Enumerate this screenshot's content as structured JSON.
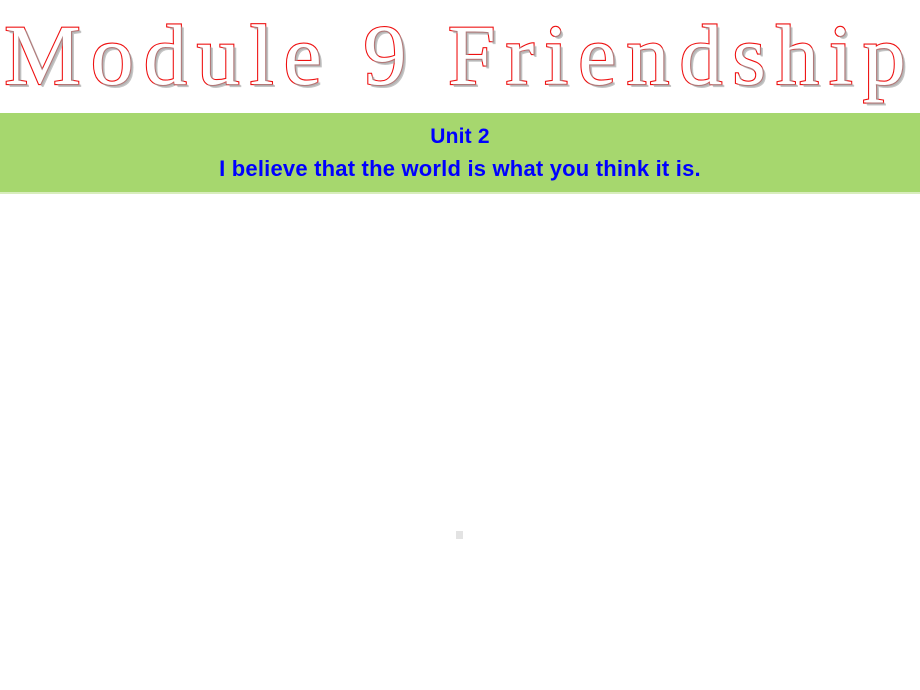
{
  "slide": {
    "title": "Module 9 Friendship",
    "banner": {
      "line1": "Unit 2",
      "line2": "I believe that the world is what you think it is."
    },
    "body": {
      "content": ""
    }
  },
  "colors": {
    "title_fill": "#FFFFFF",
    "title_outline": "#EE1111",
    "title_shadow": "#969696",
    "banner_background": "#A6D76E",
    "banner_edge": "#D8EDBD",
    "banner_text": "#0000FF",
    "body_background": "#FFFFFF",
    "stray_mark": "#E3E3E3"
  }
}
